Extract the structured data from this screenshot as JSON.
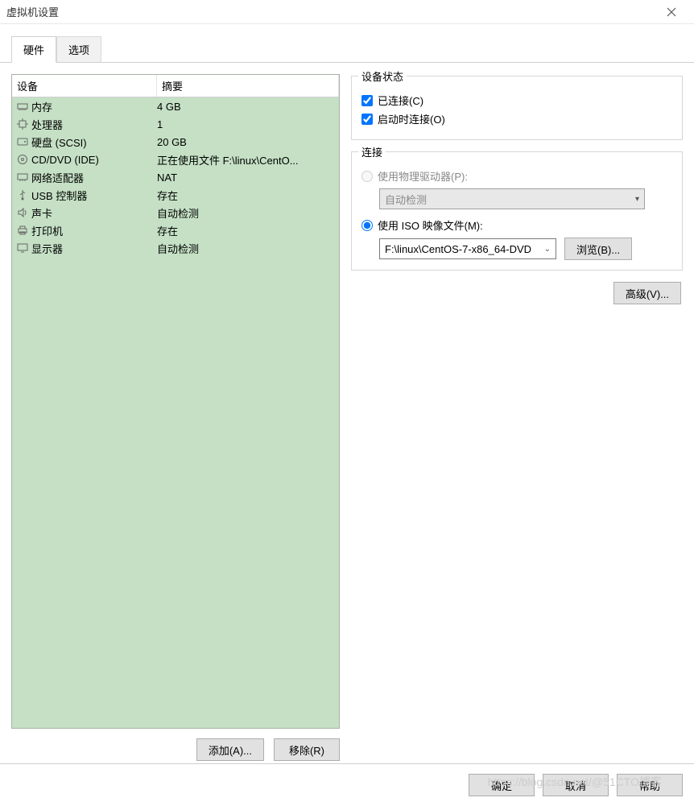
{
  "window": {
    "title": "虚拟机设置"
  },
  "tabs": {
    "hardware": "硬件",
    "options": "选项"
  },
  "list": {
    "header_device": "设备",
    "header_summary": "摘要",
    "rows": [
      {
        "name": "内存",
        "summary": "4 GB",
        "icon": "memory"
      },
      {
        "name": "处理器",
        "summary": "1",
        "icon": "cpu"
      },
      {
        "name": "硬盘 (SCSI)",
        "summary": "20 GB",
        "icon": "hdd"
      },
      {
        "name": "CD/DVD (IDE)",
        "summary": "正在使用文件 F:\\linux\\CentO...",
        "icon": "cd"
      },
      {
        "name": "网络适配器",
        "summary": "NAT",
        "icon": "nic"
      },
      {
        "name": "USB 控制器",
        "summary": "存在",
        "icon": "usb"
      },
      {
        "name": "声卡",
        "summary": "自动检测",
        "icon": "audio"
      },
      {
        "name": "打印机",
        "summary": "存在",
        "icon": "printer"
      },
      {
        "name": "显示器",
        "summary": "自动检测",
        "icon": "display"
      }
    ]
  },
  "buttons": {
    "add": "添加(A)...",
    "remove": "移除(R)",
    "browse": "浏览(B)...",
    "advanced": "高级(V)...",
    "ok": "确定",
    "cancel": "取消",
    "help": "帮助"
  },
  "status_group": {
    "title": "设备状态",
    "connected": "已连接(C)",
    "connect_at_power": "启动时连接(O)"
  },
  "connection_group": {
    "title": "连接",
    "use_physical": "使用物理驱动器(P):",
    "auto_detect": "自动检测",
    "use_iso": "使用 ISO 映像文件(M):",
    "iso_path": "F:\\linux\\CentOS-7-x86_64-DVD"
  },
  "watermark": "https://blog.csdn.net/@51CTO博客"
}
